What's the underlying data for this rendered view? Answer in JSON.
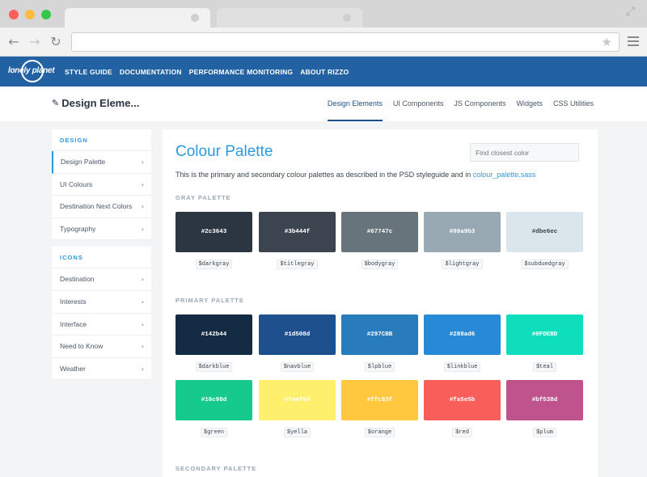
{
  "browser": {
    "colors": {
      "red": "#fc605b",
      "yellow": "#fdbc40",
      "green": "#34c84a"
    },
    "icons": [
      "back-arrow-icon",
      "forward-arrow-icon",
      "reload-icon",
      "star-icon",
      "menu-icon",
      "expand-icon"
    ]
  },
  "site": {
    "logo_text": "lonely planet",
    "nav": [
      "STYLE GUIDE",
      "DOCUMENTATION",
      "PERFORMANCE MONITORING",
      "ABOUT RIZZO"
    ],
    "header_color": "#2362a2"
  },
  "page": {
    "title": "Design Eleme...",
    "tabs": [
      "Design Elements",
      "UI Components",
      "JS Components",
      "Widgets",
      "CSS Utilities"
    ],
    "active_tab": "Design Elements"
  },
  "sidebar": {
    "design_heading": "DESIGN",
    "design_items": [
      "Design Palette",
      "UI Colours",
      "Destination Next Colors",
      "Typography"
    ],
    "icons_heading": "ICONS",
    "icons_items": [
      "Destination",
      "Interests",
      "Interface",
      "Need to Know",
      "Weather"
    ],
    "chevron": "›"
  },
  "main": {
    "heading": "Colour Palette",
    "search_placeholder": "Find closest color",
    "intro_text": "This is the primary and secondary colour palettes as described in the PSD styleguide and in ",
    "intro_link": "colour_palette.sass",
    "gray_label": "GRAY PALETTE",
    "primary_label": "PRIMARY PALETTE",
    "secondary_label": "SECONDARY PALETTE",
    "gray": [
      {
        "hex": "#2c3643",
        "var": "$darkgray"
      },
      {
        "hex": "#3b444f",
        "var": "$titlegray"
      },
      {
        "hex": "#67747c",
        "var": "$bodygray"
      },
      {
        "hex": "#99a9b3",
        "var": "$lightgray"
      },
      {
        "hex": "#dbe6ec",
        "var": "$subduedgray"
      }
    ],
    "primary": [
      {
        "hex": "#142b44",
        "var": "$darkblue"
      },
      {
        "hex": "#1d508d",
        "var": "$navblue"
      },
      {
        "hex": "#297CBB",
        "var": "$lpblue"
      },
      {
        "hex": "#288ad6",
        "var": "$linkblue"
      },
      {
        "hex": "#0FDEBD",
        "var": "$teal"
      },
      {
        "hex": "#16c98d",
        "var": "$green"
      },
      {
        "hex": "#feef6d",
        "var": "$yella"
      },
      {
        "hex": "#ffc83f",
        "var": "$orange"
      },
      {
        "hex": "#fa5e5b",
        "var": "$red"
      },
      {
        "hex": "#bf538d",
        "var": "$plum"
      }
    ]
  }
}
